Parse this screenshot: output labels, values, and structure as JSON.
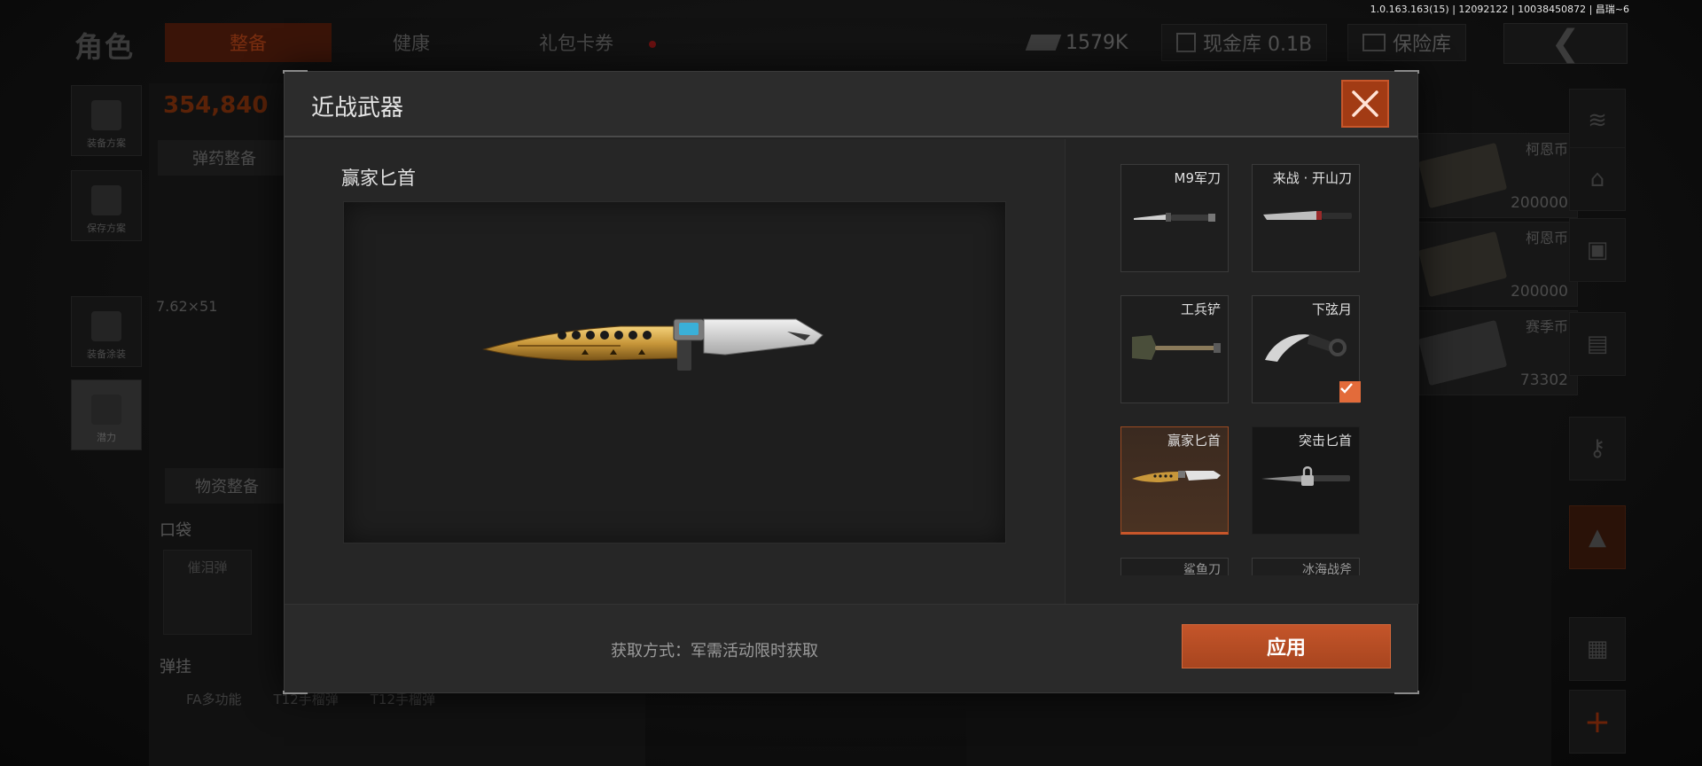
{
  "build_info": "1.0.163.163(15) | 12092122 | 10038450872 | 昌瑞~6",
  "background": {
    "role_title": "角色",
    "tabs": [
      {
        "label": "整备",
        "active": true
      },
      {
        "label": "健康",
        "active": false
      },
      {
        "label": "礼包卡券",
        "active": false
      }
    ],
    "resources": {
      "cash": "1579K",
      "vault_label": "现金库 0.1B",
      "insurance_label": "保险库"
    },
    "left_menu": [
      {
        "label": "装备方案"
      },
      {
        "label": "保存方案"
      },
      {
        "label": "装备涂装"
      },
      {
        "label": "潜力"
      }
    ],
    "money": "354,840",
    "ammo_header": "弹药整备",
    "caliber": "7.62×51",
    "supply_header": "物资整备",
    "pocket_label": "口袋",
    "pocket_item": "催泪弹",
    "hang_label": "弹挂",
    "hang_items": [
      "FA多功能",
      "T12手榴弹",
      "T12手榴弹"
    ],
    "currencies": [
      {
        "name": "柯恩币",
        "value": "200000"
      },
      {
        "name": "柯恩币",
        "value": "200000"
      },
      {
        "name": "赛季币",
        "value": "73302"
      }
    ]
  },
  "modal": {
    "title": "近战武器",
    "selected_weapon": "赢家匕首",
    "obtain_text": "获取方式：军需活动限时获取",
    "apply_label": "应用",
    "weapons": [
      {
        "name": "M9军刀",
        "icon": "bayonet-icon",
        "state": "normal"
      },
      {
        "name": "来战 · 开山刀",
        "icon": "machete-icon",
        "state": "normal"
      },
      {
        "name": "工兵铲",
        "icon": "shovel-icon",
        "state": "normal"
      },
      {
        "name": "下弦月",
        "icon": "karambit-icon",
        "state": "equipped"
      },
      {
        "name": "赢家匕首",
        "icon": "gold-dagger-icon",
        "state": "selected"
      },
      {
        "name": "突击匕首",
        "icon": "assault-dagger-icon",
        "state": "locked"
      },
      {
        "name": "鲨鱼刀",
        "icon": "shark-knife-icon",
        "state": "partial"
      },
      {
        "name": "冰海战斧",
        "icon": "ice-axe-icon",
        "state": "partial"
      }
    ]
  },
  "colors": {
    "accent": "#c4552a",
    "check": "#e36b3a",
    "modal_bg": "#222222",
    "gold": "#c8973a"
  }
}
